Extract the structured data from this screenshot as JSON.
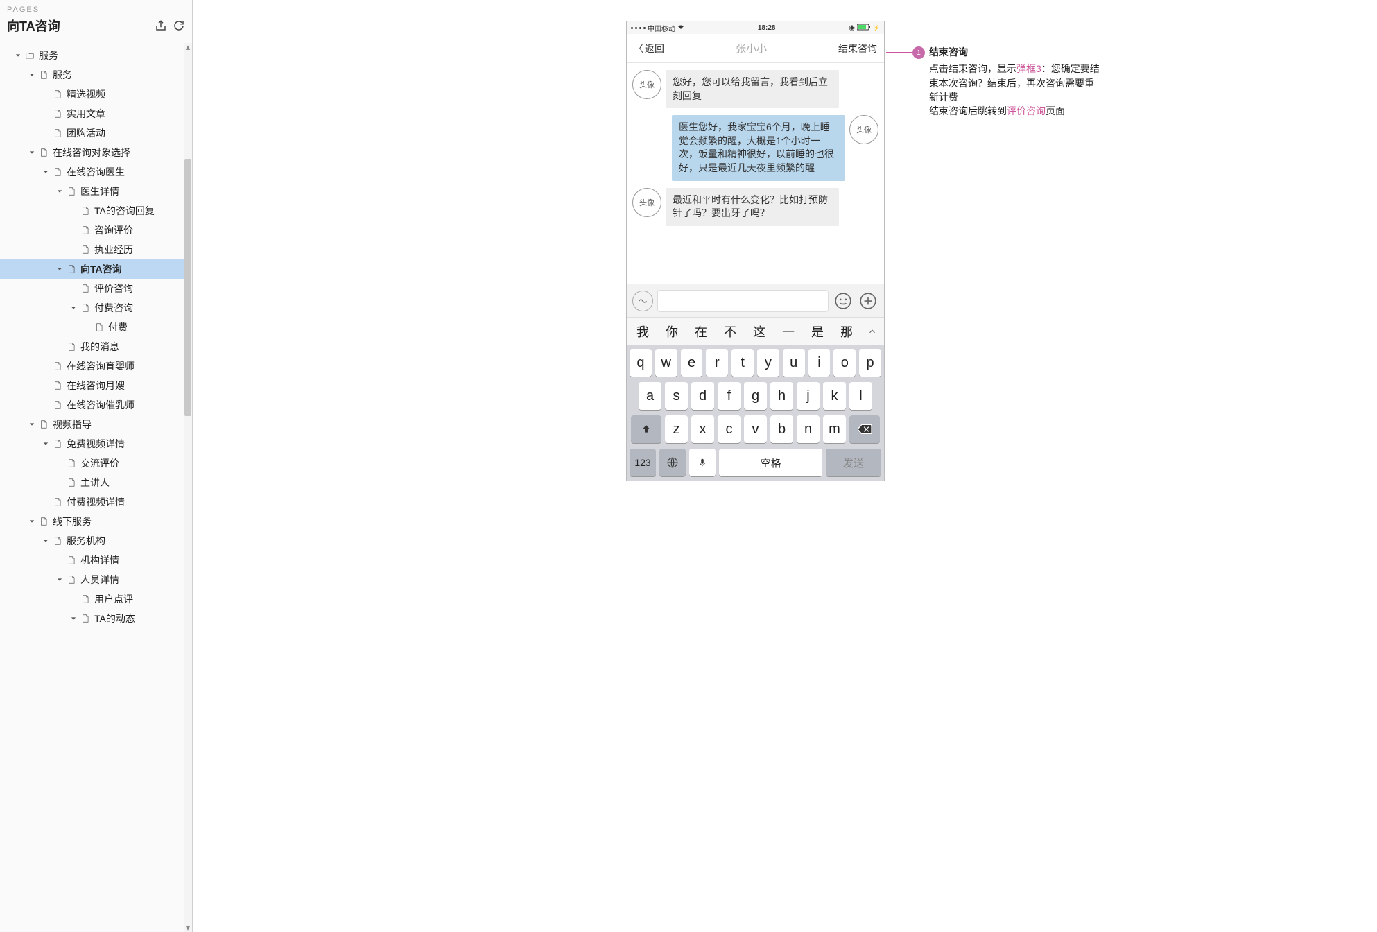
{
  "sidebar": {
    "pages_label": "PAGES",
    "title": "向TA咨询",
    "tree": [
      {
        "depth": 0,
        "exp": true,
        "kind": "folder",
        "label": "服务"
      },
      {
        "depth": 1,
        "exp": true,
        "kind": "page",
        "label": "服务"
      },
      {
        "depth": 2,
        "exp": false,
        "kind": "page",
        "label": "精选视频"
      },
      {
        "depth": 2,
        "exp": false,
        "kind": "page",
        "label": "实用文章"
      },
      {
        "depth": 2,
        "exp": false,
        "kind": "page",
        "label": "团购活动"
      },
      {
        "depth": 1,
        "exp": true,
        "kind": "page",
        "label": "在线咨询对象选择"
      },
      {
        "depth": 2,
        "exp": true,
        "kind": "page",
        "label": "在线咨询医生"
      },
      {
        "depth": 3,
        "exp": true,
        "kind": "page",
        "label": "医生详情"
      },
      {
        "depth": 4,
        "exp": false,
        "kind": "page",
        "label": "TA的咨询回复"
      },
      {
        "depth": 4,
        "exp": false,
        "kind": "page",
        "label": "咨询评价"
      },
      {
        "depth": 4,
        "exp": false,
        "kind": "page",
        "label": "执业经历"
      },
      {
        "depth": 3,
        "exp": true,
        "kind": "page",
        "label": "向TA咨询",
        "selected": true
      },
      {
        "depth": 4,
        "exp": false,
        "kind": "page",
        "label": "评价咨询"
      },
      {
        "depth": 4,
        "exp": true,
        "kind": "page",
        "label": "付费咨询"
      },
      {
        "depth": 5,
        "exp": false,
        "kind": "page",
        "label": "付费"
      },
      {
        "depth": 3,
        "exp": false,
        "kind": "page",
        "label": "我的消息"
      },
      {
        "depth": 2,
        "exp": false,
        "kind": "page",
        "label": "在线咨询育婴师"
      },
      {
        "depth": 2,
        "exp": false,
        "kind": "page",
        "label": "在线咨询月嫂"
      },
      {
        "depth": 2,
        "exp": false,
        "kind": "page",
        "label": "在线咨询催乳师"
      },
      {
        "depth": 1,
        "exp": true,
        "kind": "page",
        "label": "视频指导"
      },
      {
        "depth": 2,
        "exp": true,
        "kind": "page",
        "label": "免费视频详情"
      },
      {
        "depth": 3,
        "exp": false,
        "kind": "page",
        "label": "交流评价"
      },
      {
        "depth": 3,
        "exp": false,
        "kind": "page",
        "label": "主讲人"
      },
      {
        "depth": 2,
        "exp": false,
        "kind": "page",
        "label": "付费视频详情"
      },
      {
        "depth": 1,
        "exp": true,
        "kind": "page",
        "label": "线下服务"
      },
      {
        "depth": 2,
        "exp": true,
        "kind": "page",
        "label": "服务机构"
      },
      {
        "depth": 3,
        "exp": false,
        "kind": "page",
        "label": "机构详情"
      },
      {
        "depth": 3,
        "exp": true,
        "kind": "page",
        "label": "人员详情"
      },
      {
        "depth": 4,
        "exp": false,
        "kind": "page",
        "label": "用户点评"
      },
      {
        "depth": 4,
        "exp": true,
        "kind": "page",
        "label": "TA的动态"
      }
    ]
  },
  "phone": {
    "status": {
      "carrier": "中国移动",
      "time": "18:28"
    },
    "nav": {
      "back": "返回",
      "title": "张小小",
      "end": "结束咨询"
    },
    "avatar_label": "头像",
    "messages": [
      {
        "side": "left",
        "text": "您好，您可以给我留言，我看到后立刻回复"
      },
      {
        "side": "right",
        "text": "医生您好，我家宝宝6个月，晚上睡觉会频繁的醒，大概是1个小时一次，饭量和精神很好，以前睡的也很好，只是最近几天夜里频繁的醒"
      },
      {
        "side": "left",
        "text": "最近和平时有什么变化？比如打预防针了吗？要出牙了吗？"
      }
    ],
    "predictions": [
      "我",
      "你",
      "在",
      "不",
      "这",
      "一",
      "是",
      "那"
    ],
    "keyboard": {
      "row1": [
        "q",
        "w",
        "e",
        "r",
        "t",
        "y",
        "u",
        "i",
        "o",
        "p"
      ],
      "row2": [
        "a",
        "s",
        "d",
        "f",
        "g",
        "h",
        "j",
        "k",
        "l"
      ],
      "row3": [
        "z",
        "x",
        "c",
        "v",
        "b",
        "n",
        "m"
      ],
      "num": "123",
      "space": "空格",
      "send": "发送"
    }
  },
  "annotation": {
    "badge": "1",
    "title": "结束咨询",
    "line1_pre": "点击结束咨询，显示",
    "line1_link": "弹框3",
    "line1_post": "：您确定要结束本次咨询？结束后，再次咨询需要重新计费",
    "line2_pre": "结束咨询后跳转到",
    "line2_link": "评价咨询",
    "line2_post": "页面"
  }
}
